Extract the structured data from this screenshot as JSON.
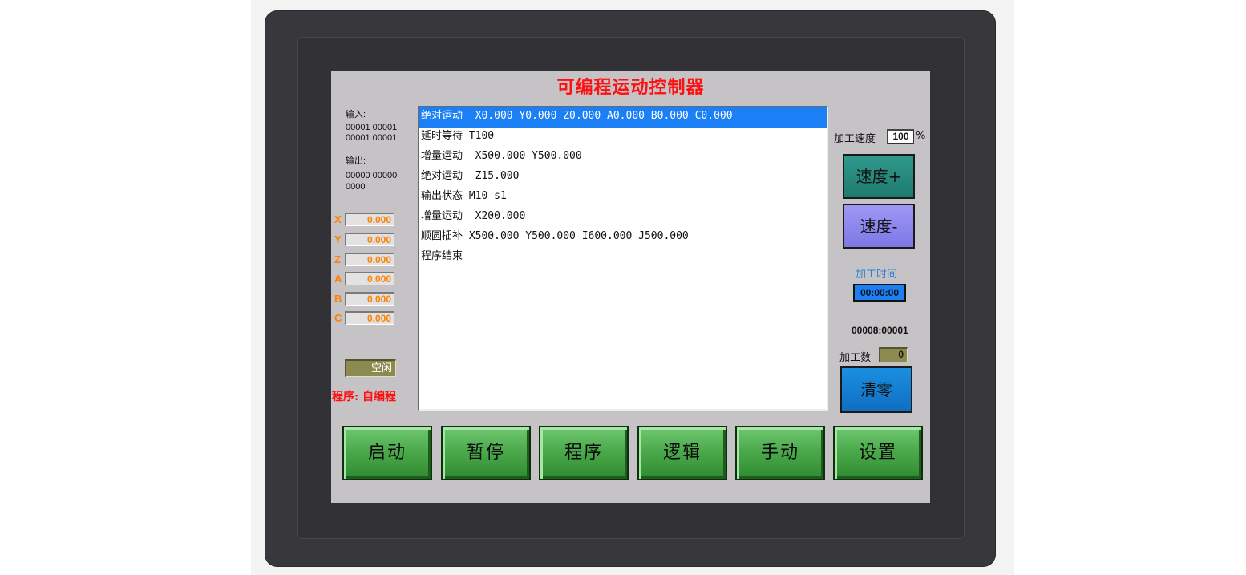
{
  "title": "可编程运动控制器",
  "io": {
    "input_label": "输入:",
    "input_line1": "00001 00001",
    "input_line2": "00001 00001",
    "output_label": "输出:",
    "output_line1": "00000 00000",
    "output_line2": "0000"
  },
  "axes": [
    {
      "name": "X",
      "value": "0.000"
    },
    {
      "name": "Y",
      "value": "0.000"
    },
    {
      "name": "Z",
      "value": "0.000"
    },
    {
      "name": "A",
      "value": "0.000"
    },
    {
      "name": "B",
      "value": "0.000"
    },
    {
      "name": "C",
      "value": "0.000"
    }
  ],
  "status": "空闲",
  "program_label": "程序: 自编程",
  "program_lines": [
    "绝对运动  X0.000 Y0.000 Z0.000 A0.000 B0.000 C0.000",
    "延时等待 T100",
    "增量运动  X500.000 Y500.000",
    "绝对运动  Z15.000",
    "输出状态 M10 s1",
    "增量运动  X200.000",
    "顺圆插补 X500.000 Y500.000 I600.000 J500.000",
    "程序结束"
  ],
  "speed": {
    "label": "加工速度",
    "value": "100",
    "unit": "%",
    "inc_label": "速度+",
    "dec_label": "速度-"
  },
  "time": {
    "label": "加工时间",
    "value": "00:00:00"
  },
  "counter": "00008:00001",
  "count": {
    "label": "加工数",
    "value": "0",
    "clear_label": "清零"
  },
  "buttons": [
    "启动",
    "暂停",
    "程序",
    "逻辑",
    "手动",
    "设置"
  ],
  "colors": {
    "title": "#ff1010",
    "axis": "#ff8000",
    "selection": "#1b7ff5",
    "main_button": "#4caa4c",
    "speed_plus": "#1f7a6e",
    "speed_minus": "#7e78e6",
    "clear": "#1b8fe0"
  }
}
